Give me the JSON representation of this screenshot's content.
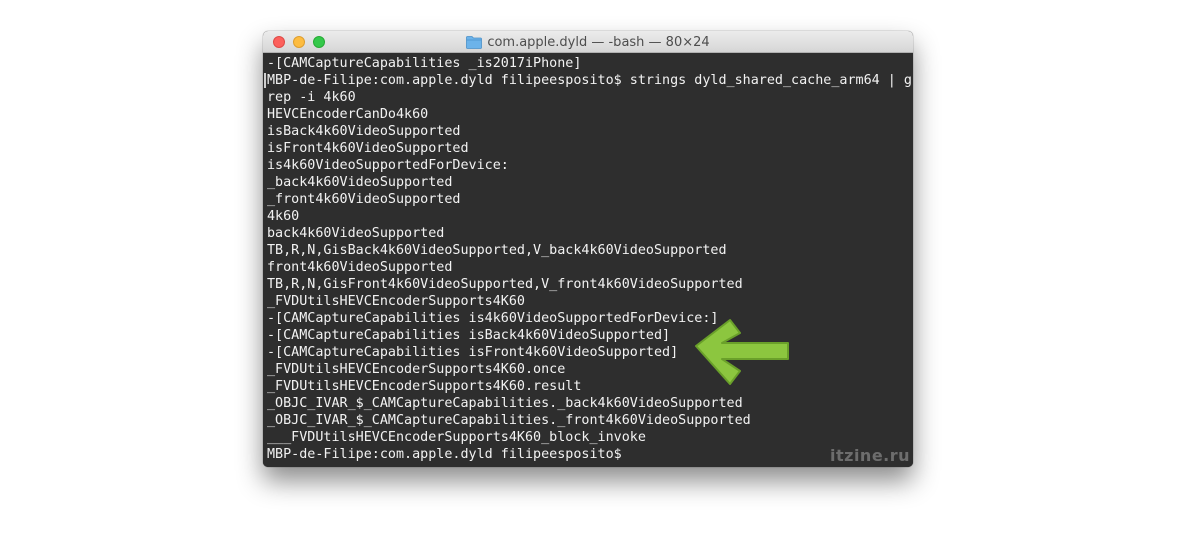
{
  "window": {
    "title": "com.apple.dyld — -bash — 80×24"
  },
  "terminal": {
    "lines": [
      "-[CAMCaptureCapabilities _is2017iPhone]",
      "MBP-de-Filipe:com.apple.dyld filipeesposito$ strings dyld_shared_cache_arm64 | g",
      "rep -i 4k60",
      "HEVCEncoderCanDo4k60",
      "isBack4k60VideoSupported",
      "isFront4k60VideoSupported",
      "is4k60VideoSupportedForDevice:",
      "_back4k60VideoSupported",
      "_front4k60VideoSupported",
      "4k60",
      "back4k60VideoSupported",
      "TB,R,N,GisBack4k60VideoSupported,V_back4k60VideoSupported",
      "front4k60VideoSupported",
      "TB,R,N,GisFront4k60VideoSupported,V_front4k60VideoSupported",
      "_FVDUtilsHEVCEncoderSupports4K60",
      "-[CAMCaptureCapabilities is4k60VideoSupportedForDevice:]",
      "-[CAMCaptureCapabilities isBack4k60VideoSupported]",
      "-[CAMCaptureCapabilities isFront4k60VideoSupported]",
      "_FVDUtilsHEVCEncoderSupports4K60.once",
      "_FVDUtilsHEVCEncoderSupports4K60.result",
      "_OBJC_IVAR_$_CAMCaptureCapabilities._back4k60VideoSupported",
      "_OBJC_IVAR_$_CAMCaptureCapabilities._front4k60VideoSupported",
      "___FVDUtilsHEVCEncoderSupports4K60_block_invoke",
      "MBP-de-Filipe:com.apple.dyld filipeesposito$"
    ]
  },
  "watermark": "itzine.ru",
  "icons": {
    "close": "close-traffic-light-icon",
    "minimize": "minimize-traffic-light-icon",
    "zoom": "zoom-traffic-light-icon",
    "folder": "folder-icon",
    "arrow": "arrow-left-icon"
  },
  "colors": {
    "terminal_background": "#2e2e2e",
    "terminal_text": "#f2f2f2",
    "arrow": "#8cc63f"
  }
}
